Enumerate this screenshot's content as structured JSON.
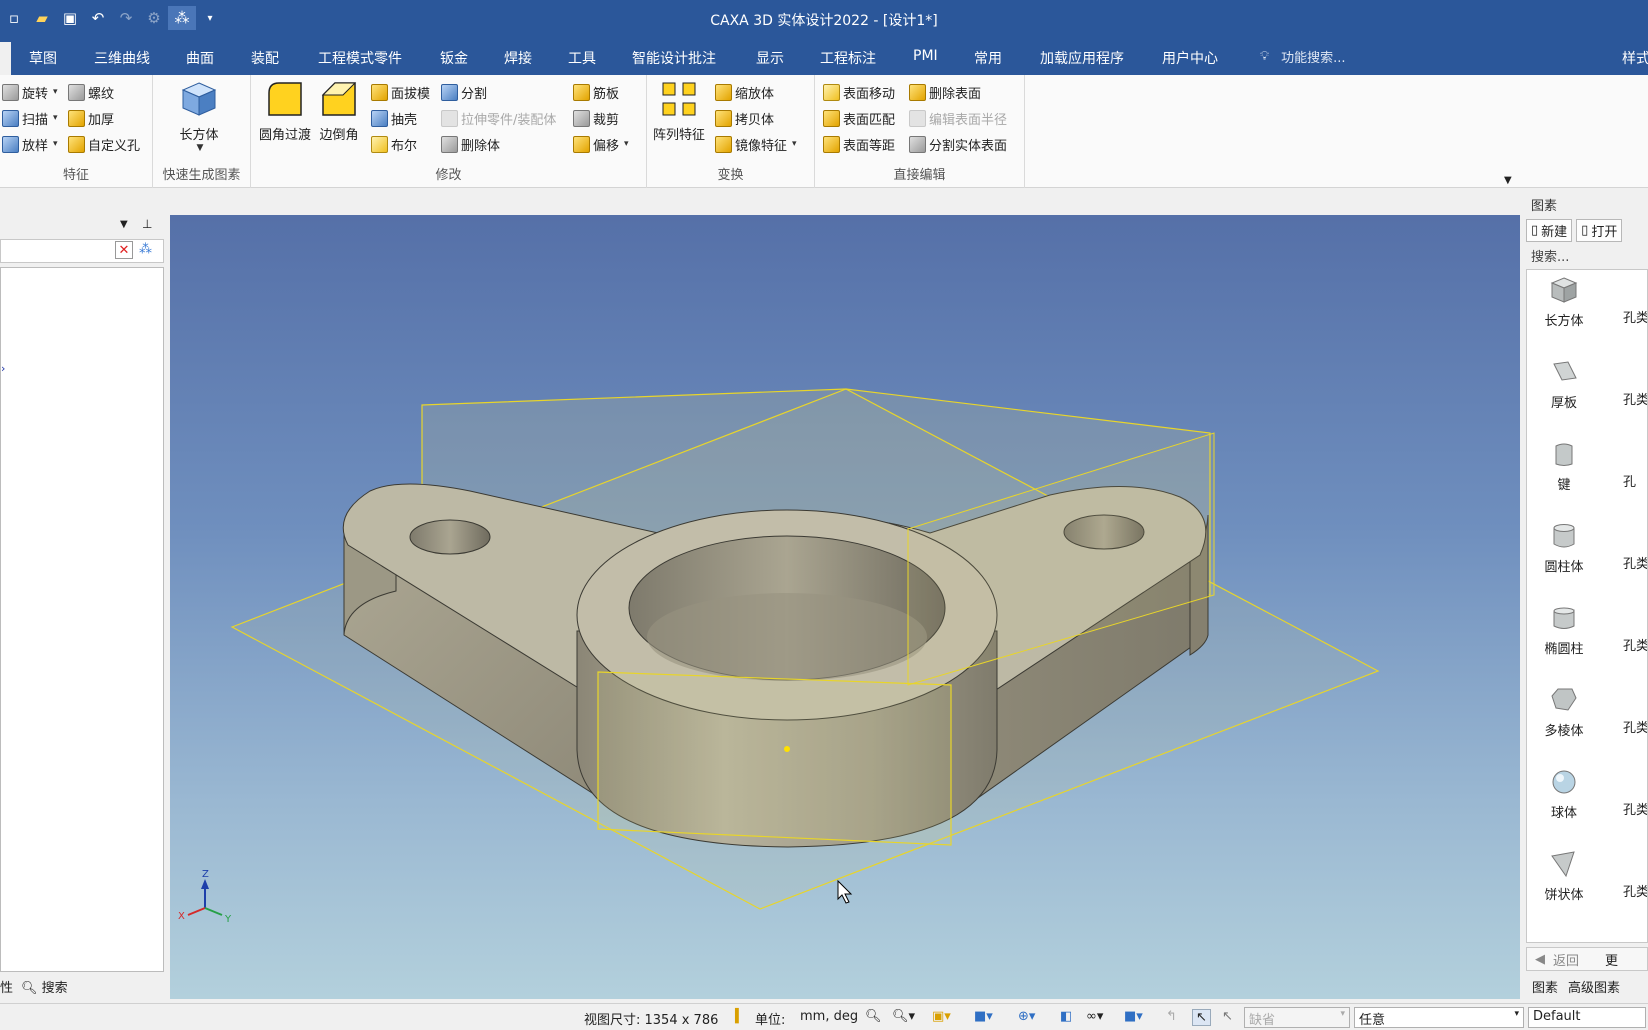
{
  "window": {
    "title": "CAXA 3D 实体设计2022 - [设计1*]"
  },
  "qat": {
    "icons": [
      "new-icon",
      "open-folder-icon",
      "save-icon",
      "undo-icon",
      "redo-icon",
      "gear-icon",
      "design-tree-icon",
      "dropdown-icon"
    ]
  },
  "tabs": [
    "草图",
    "三维曲线",
    "曲面",
    "装配",
    "工程模式零件",
    "钣金",
    "焊接",
    "工具",
    "智能设计批注",
    "显示",
    "工程标注",
    "PMI",
    "常用",
    "加载应用程序",
    "用户中心"
  ],
  "search": {
    "placeholder": "功能搜索...",
    "style_label": "样式"
  },
  "ribbon": {
    "features": {
      "label": "特征",
      "revolve": "旋转",
      "sweep": "扫描",
      "loft": "放样",
      "thread": "螺纹",
      "thicken": "加厚",
      "custom_hole": "自定义孔"
    },
    "quick": {
      "label": "快速生成图素",
      "box": "长方体"
    },
    "modify": {
      "label": "修改",
      "fillet": "圆角过渡",
      "chamfer": "边倒角",
      "draft": "面拔模",
      "shell": "抽壳",
      "boolean": "布尔",
      "split": "分割",
      "stretch": "拉伸零件/装配体",
      "delete_body": "删除体",
      "rib": "筋板",
      "trim": "裁剪",
      "offset": "偏移"
    },
    "transform": {
      "label": "变换",
      "pattern": "阵列特征",
      "scale": "缩放体",
      "copy": "拷贝体",
      "mirror": "镜像特征"
    },
    "direct_edit": {
      "label": "直接编辑",
      "move_face": "表面移动",
      "match_face": "表面匹配",
      "offset_face": "表面等距",
      "delete_face": "删除表面",
      "edit_radius": "编辑表面半径",
      "split_face": "分割实体表面"
    }
  },
  "left_panel": {
    "footer_tab_1": "性",
    "footer_tab_2": "搜索"
  },
  "viewport": {
    "triad": {
      "x": "X",
      "y": "Y",
      "z": "Z"
    }
  },
  "right_panel": {
    "title": "图素",
    "new_label": "新建",
    "open_label": "打开",
    "search_label": "搜索...",
    "elements": [
      "长方体",
      "厚板",
      "键",
      "圆柱体",
      "椭圆柱",
      "多棱体",
      "球体",
      "饼状体"
    ],
    "hole_labels": [
      "孔类",
      "孔类",
      "孔",
      "孔类",
      "孔类",
      "孔类",
      "孔类",
      "孔类"
    ],
    "back_label": "返回",
    "more_label": "更",
    "tab_elements": "图素",
    "tab_advanced": "高级图素"
  },
  "statusbar": {
    "view_size": "视图尺寸: 1354 x  786",
    "unit_label": "单位:",
    "unit_value": "mm, deg",
    "combo_disabled": "缺省",
    "combo_any": "任意",
    "combo_default": "Default"
  },
  "colors": {
    "title_bar": "#2b579a",
    "accent_yellow": "#e2a400",
    "plane_outline": "#e8d52a",
    "part_body": "#bdb9a7"
  }
}
